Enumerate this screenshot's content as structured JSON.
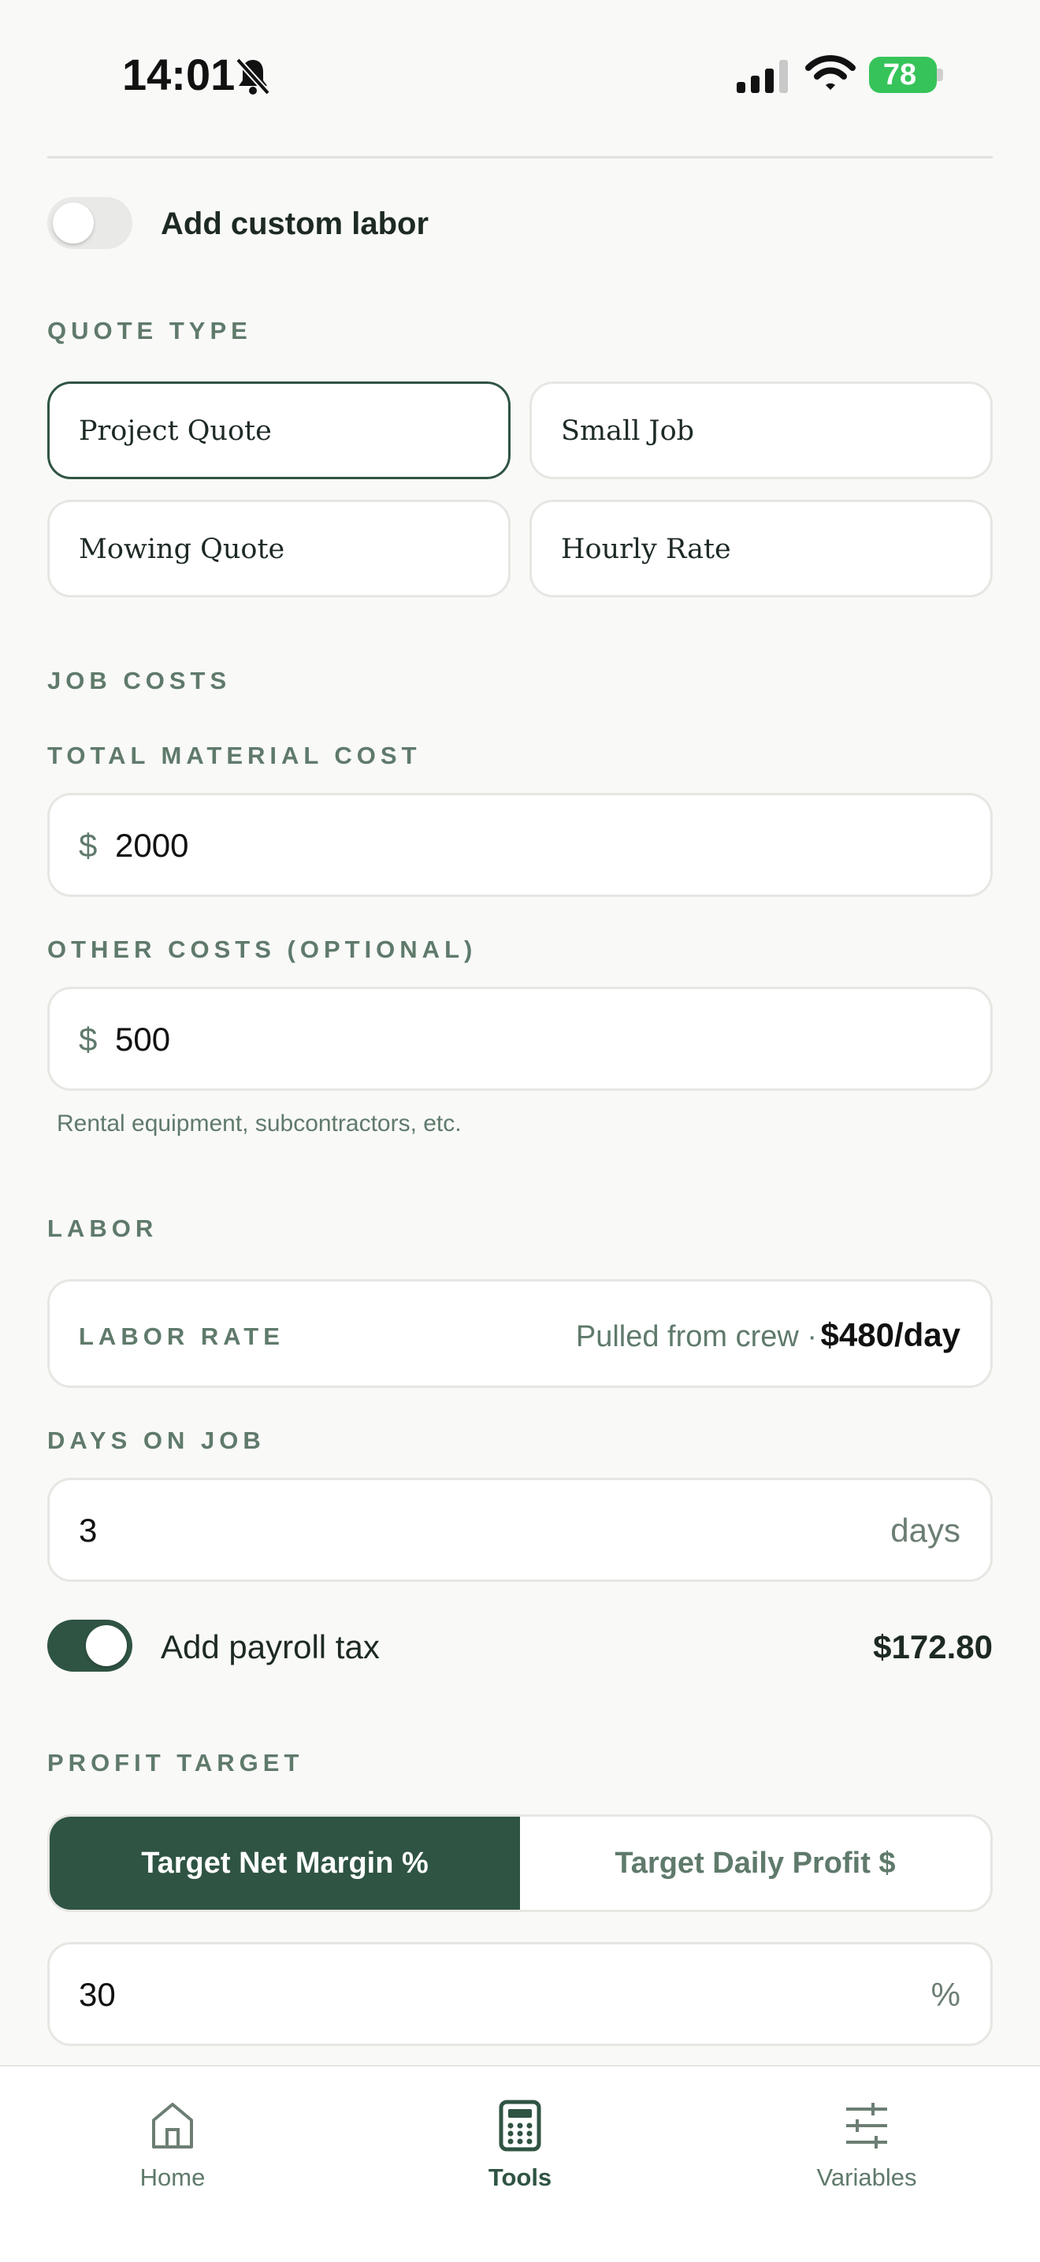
{
  "status_bar": {
    "time": "14:01",
    "battery": "78"
  },
  "custom_labor": {
    "label": "Add custom labor",
    "enabled": false
  },
  "quote_type": {
    "section_label": "QUOTE TYPE",
    "options": [
      "Project Quote",
      "Small Job",
      "Mowing Quote",
      "Hourly Rate"
    ],
    "selected": "Project Quote"
  },
  "job_costs": {
    "section_label": "JOB COSTS",
    "material": {
      "label": "TOTAL MATERIAL COST",
      "prefix": "$",
      "value": "2000"
    },
    "other": {
      "label": "OTHER COSTS (OPTIONAL)",
      "prefix": "$",
      "value": "500",
      "hint": "Rental equipment, subcontractors, etc."
    }
  },
  "labor": {
    "section_label": "LABOR",
    "rate_label": "LABOR RATE",
    "rate_source": "Pulled from crew ·",
    "rate_value": "$480/day",
    "days_label": "DAYS ON JOB",
    "days_value": "3",
    "days_unit": "days",
    "payroll_label": "Add payroll tax",
    "payroll_enabled": true,
    "payroll_value": "$172.80"
  },
  "profit_target": {
    "section_label": "PROFIT TARGET",
    "modes": [
      "Target Net Margin %",
      "Target Daily Profit $"
    ],
    "active_mode": "Target Net Margin %",
    "value": "30",
    "unit": "%"
  },
  "tab_bar": {
    "tabs": [
      {
        "label": "Home",
        "icon": "home-icon"
      },
      {
        "label": "Tools",
        "icon": "calculator-icon"
      },
      {
        "label": "Variables",
        "icon": "sliders-icon"
      }
    ],
    "active": "Tools"
  },
  "colors": {
    "accent": "#2f5443",
    "muted": "#5f7a6b",
    "battery": "#36c45a"
  }
}
